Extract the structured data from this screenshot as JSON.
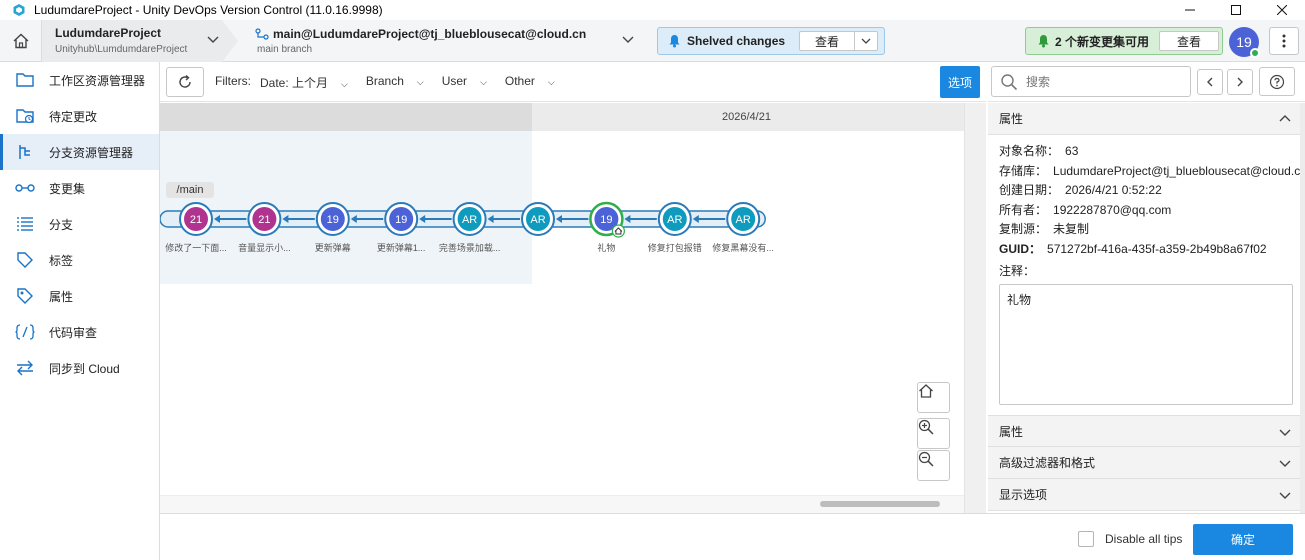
{
  "window": {
    "title": "LudumdareProject - Unity DevOps Version Control (11.0.16.9998)"
  },
  "toolbar": {
    "workspace_name": "LudumdareProject",
    "workspace_path": "Unityhub\\LumdumdareProject",
    "branch_name": "main@LudumdareProject@tj_blueblousecat@cloud.cn",
    "branch_sub": "main branch",
    "shelved_label": "Shelved changes",
    "shelved_view": "查看",
    "new_changes_label": "2 个新变更集可用",
    "new_changes_view": "查看",
    "avatar_text": "19"
  },
  "sidebar": {
    "items": [
      {
        "label": "工作区资源管理器",
        "icon": "folder-icon"
      },
      {
        "label": "待定更改",
        "icon": "pending-changes-icon"
      },
      {
        "label": "分支资源管理器",
        "icon": "branch-icon",
        "active": true
      },
      {
        "label": "变更集",
        "icon": "changeset-icon"
      },
      {
        "label": "分支",
        "icon": "list-icon"
      },
      {
        "label": "标签",
        "icon": "tag-icon"
      },
      {
        "label": "属性",
        "icon": "attribute-icon"
      },
      {
        "label": "代码审查",
        "icon": "code-review-icon"
      },
      {
        "label": "同步到 Cloud",
        "icon": "sync-icon"
      }
    ]
  },
  "subbar": {
    "filters_label": "Filters:",
    "date_filter": "Date: 上个月",
    "branch_filter": "Branch",
    "user_filter": "User",
    "other_filter": "Other",
    "options_button": "选项"
  },
  "graph": {
    "date": "2026/4/21",
    "branch_label": "/main",
    "changesets": [
      {
        "avatar": "21",
        "label": "修改了一下面...",
        "color": "#b0338f"
      },
      {
        "avatar": "21",
        "label": "音量显示小...",
        "color": "#b0338f"
      },
      {
        "avatar": "19",
        "label": "更新弹幕",
        "color": "#4c63d8"
      },
      {
        "avatar": "19",
        "label": "更新弹幕1...",
        "color": "#4c63d8"
      },
      {
        "avatar": "AR",
        "label": "完善场景加载...",
        "color": "#0e9bbd"
      },
      {
        "avatar": "AR",
        "label": "",
        "color": "#0e9bbd"
      },
      {
        "avatar": "19",
        "label": "礼物",
        "color": "#4c63d8",
        "selected": true
      },
      {
        "avatar": "AR",
        "label": "修复打包报错",
        "color": "#0e9bbd"
      },
      {
        "avatar": "AR",
        "label": "修复黑幕没有...",
        "color": "#0e9bbd"
      }
    ]
  },
  "search": {
    "placeholder": "搜索"
  },
  "properties": {
    "header": "属性",
    "object_name_key": "对象名称：",
    "object_name": "63",
    "repository_key": "存储库：",
    "repository": "LudumdareProject@tj_blueblousecat@cloud.cn",
    "created_key": "创建日期：",
    "created": "2026/4/21 0:52:22",
    "owner_key": "所有者：",
    "owner": "1922287870@qq.com",
    "replication_key": "复制源：",
    "replication": "未复制",
    "guid_key": "GUID：",
    "guid": "571272bf-416a-435f-a359-2b49b8a67f02",
    "comment_key": "注释：",
    "comment": "礼物"
  },
  "sections": {
    "attributes": "属性",
    "advanced_filters": "高级过滤器和格式",
    "display_options": "显示选项"
  },
  "bottom": {
    "disable_tips": "Disable all tips",
    "ok_button": "确定"
  },
  "colors": {
    "accent": "#1a88e0",
    "branch_line": "#2b7bb9",
    "selected_ring": "#2fae4b"
  }
}
